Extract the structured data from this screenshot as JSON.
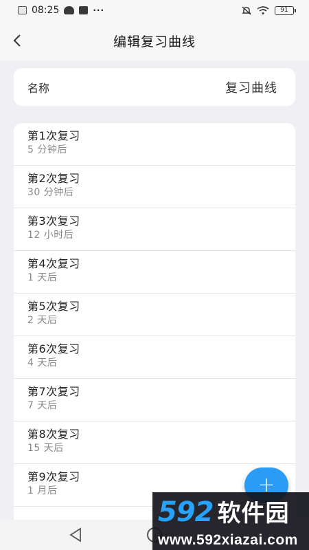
{
  "status_bar": {
    "time": "08:25",
    "battery": "91",
    "dots": "···"
  },
  "header": {
    "title": "编辑复习曲线"
  },
  "name_field": {
    "label": "名称",
    "value": "复习曲线"
  },
  "review_items": [
    {
      "title": "第1次复习",
      "interval": "5 分钟后"
    },
    {
      "title": "第2次复习",
      "interval": "30 分钟后"
    },
    {
      "title": "第3次复习",
      "interval": "12 小时后"
    },
    {
      "title": "第4次复习",
      "interval": "1 天后"
    },
    {
      "title": "第5次复习",
      "interval": "2 天后"
    },
    {
      "title": "第6次复习",
      "interval": "4 天后"
    },
    {
      "title": "第7次复习",
      "interval": "7 天后"
    },
    {
      "title": "第8次复习",
      "interval": "15 天后"
    },
    {
      "title": "第9次复习",
      "interval": "1 月后"
    }
  ],
  "fab": {
    "label": "+",
    "color": "#2a9cf5"
  },
  "watermark": {
    "number": "592",
    "text": "软件园",
    "url": "www.592xiazai.com"
  },
  "icons": [
    "close-notification-icon",
    "cloud-icon",
    "mail-icon",
    "mute-bell-icon",
    "wifi-icon",
    "battery-icon",
    "back-arrow-icon",
    "plus-icon",
    "nav-back-icon",
    "nav-home-icon"
  ]
}
